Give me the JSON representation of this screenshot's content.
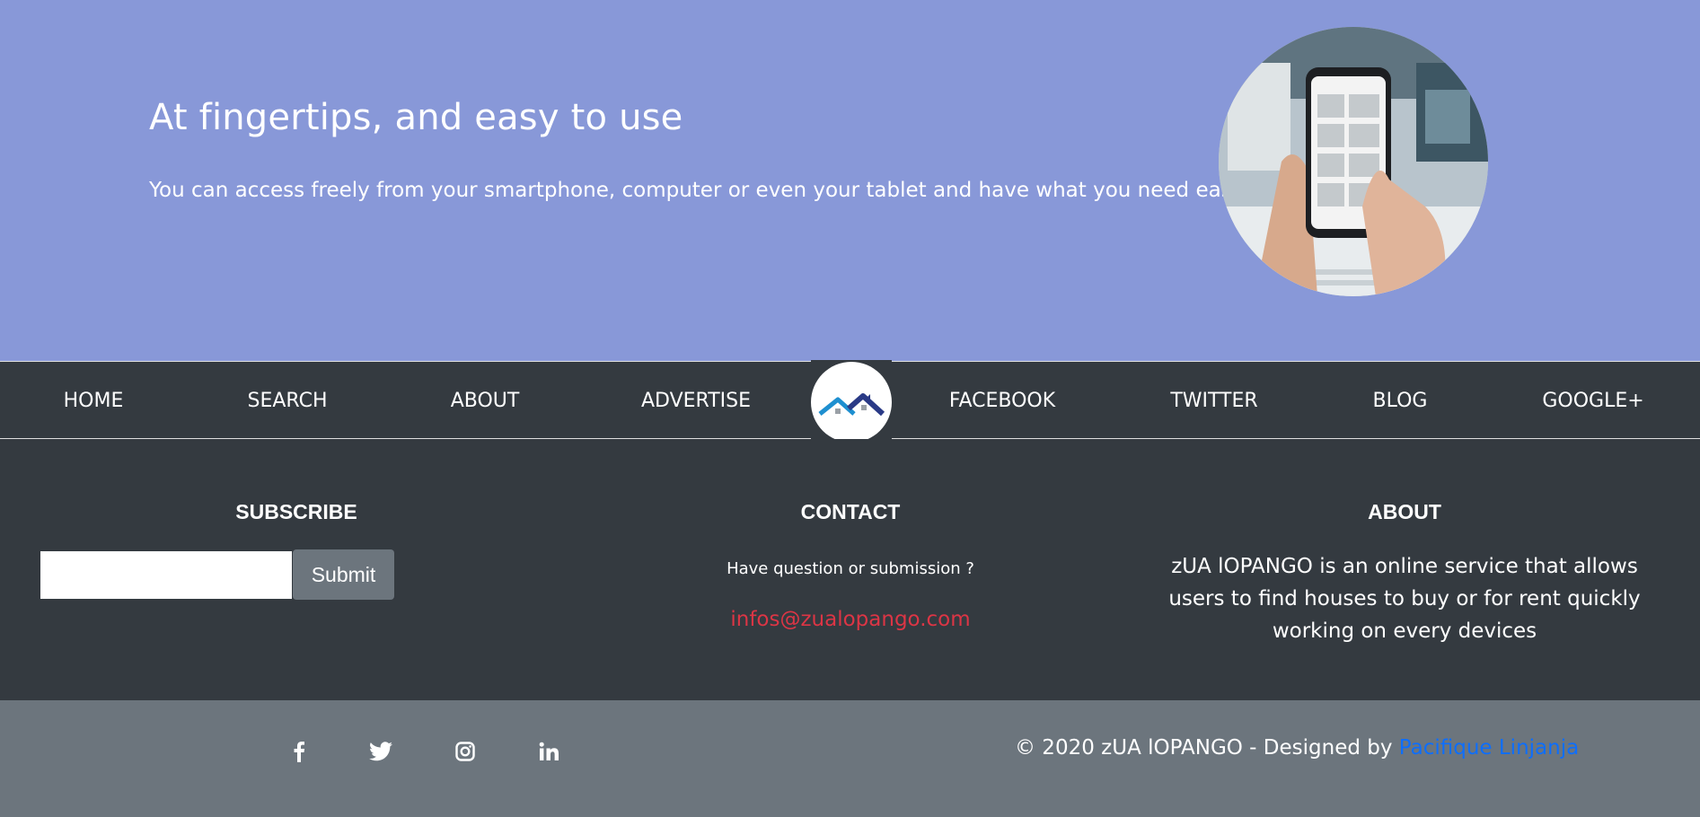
{
  "hero": {
    "title": "At fingertips, and easy to use",
    "subtitle": "You can access freely from your smartphone, computer or even your tablet and have what you need easily"
  },
  "nav": {
    "home": "HOME",
    "search": "SEARCH",
    "about": "ABOUT",
    "advertise": "ADVERTISE",
    "facebook": "FACEBOOK",
    "twitter": "TWITTER",
    "blog": "BLOG",
    "google": "GOOGLE+"
  },
  "subscribe": {
    "title": "SUBSCRIBE",
    "input_value": "",
    "button": "Submit"
  },
  "contact": {
    "title": "CONTACT",
    "question": "Have question or submission ?",
    "email": "infos@zualopango.com"
  },
  "about": {
    "title": "ABOUT",
    "text": "zUA lOPANGO is an online service that allows users to find houses to buy or for rent quickly working on every devices"
  },
  "footer": {
    "copyright": "© 2020 zUA lOPANGO - Designed by ",
    "designer": "Pacifique Linjanja",
    "social_icons": [
      "facebook-icon",
      "twitter-icon",
      "instagram-icon",
      "linkedin-icon"
    ]
  },
  "colors": {
    "hero_bg": "#8898d8",
    "dark_bg": "#343a40",
    "bottom_bg": "#6c757d",
    "email": "#dc3545",
    "link": "#0d6efd"
  }
}
